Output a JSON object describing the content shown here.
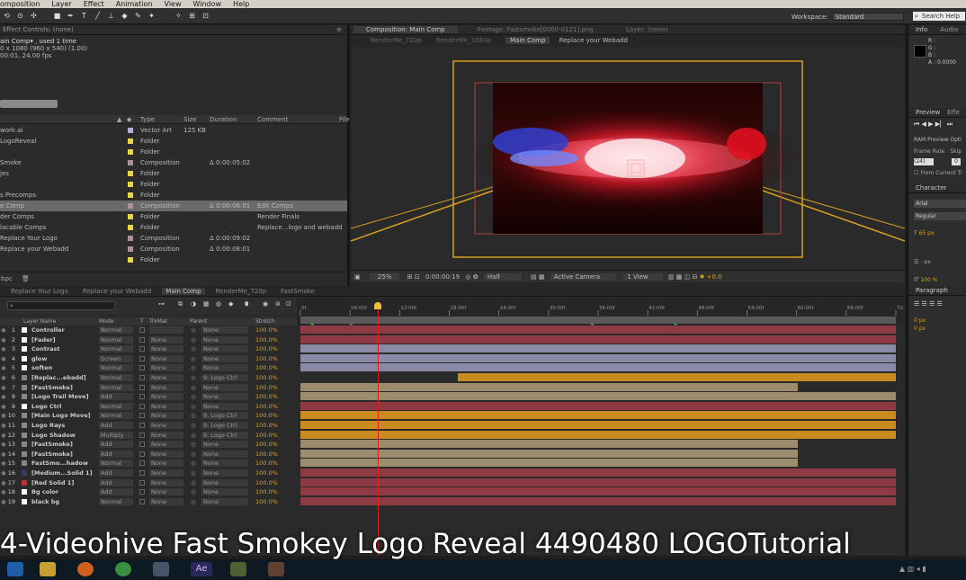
{
  "menu": [
    "omposition",
    "Layer",
    "Effect",
    "Animation",
    "View",
    "Window",
    "Help"
  ],
  "workspace": {
    "label": "Workspace:",
    "value": "Standard"
  },
  "search_label": "Search Help",
  "effect_controls": {
    "header": "Effect Controls: (none)",
    "comp_name": "ain Comp▾ , used 1 time",
    "size": "0 x 1080 (960 x 540) (1.00)",
    "duration": "00:01, 24.00 fps"
  },
  "project": {
    "headers": {
      "type": "Type",
      "size": "Size",
      "duration": "Duration",
      "comment": "Comment",
      "file": "File"
    },
    "rows": [
      {
        "name": "work.ai",
        "color": "#b0b0d8",
        "type": "Vector Art",
        "size": "125 KB",
        "duration": "",
        "comment": ""
      },
      {
        "name": "LogoReveal",
        "color": "#e8d840",
        "type": "Folder",
        "size": "",
        "duration": "",
        "comment": ""
      },
      {
        "name": "",
        "color": "#e8d840",
        "type": "Folder",
        "size": "",
        "duration": "",
        "comment": ""
      },
      {
        "name": "Smoke",
        "color": "#b09090",
        "type": "Composition",
        "size": "",
        "duration": "Δ 0:00:05:02",
        "comment": ""
      },
      {
        "name": "jes",
        "color": "#e8d840",
        "type": "Folder",
        "size": "",
        "duration": "",
        "comment": ""
      },
      {
        "name": "",
        "color": "#e8d840",
        "type": "Folder",
        "size": "",
        "duration": "",
        "comment": ""
      },
      {
        "name": "s Precomps",
        "color": "#e8d840",
        "type": "Folder",
        "size": "",
        "duration": "",
        "comment": ""
      },
      {
        "name": "e Comp",
        "color": "#b09090",
        "type": "Composition",
        "size": "",
        "duration": "Δ 0:00:06:01",
        "comment": "Edit Comps",
        "sel": true
      },
      {
        "name": "der Comps",
        "color": "#e8d840",
        "type": "Folder",
        "size": "",
        "duration": "",
        "comment": "Render Finals"
      },
      {
        "name": "lacable Comps",
        "color": "#e8d840",
        "type": "Folder",
        "size": "",
        "duration": "",
        "comment": "Replace...logo and webadd"
      },
      {
        "name": "Replace Your Logo",
        "color": "#b09090",
        "type": "Composition",
        "size": "",
        "duration": "Δ 0:00:09:02",
        "comment": ""
      },
      {
        "name": "Replace your Webadd",
        "color": "#b09090",
        "type": "Composition",
        "size": "",
        "duration": "Δ 0:00:08:01",
        "comment": ""
      },
      {
        "name": "",
        "color": "#e8d840",
        "type": "Folder",
        "size": "",
        "duration": "",
        "comment": ""
      }
    ],
    "bpc": "bpc"
  },
  "comp_viewer": {
    "header": "Composition: Main Comp",
    "footage_tab": "Footage: Fastsmoke[0000-0121].png",
    "layer_tab": "Layer: (none)",
    "subtabs": [
      "RenderMe_720p",
      "RenderMe_1080p",
      "Main Comp",
      "Replace your Webadd"
    ],
    "zoom": "25%",
    "timecode": "0:00:00:19",
    "resolution": "Half",
    "camera": "Active Camera",
    "views": "1 View",
    "exposure": "+0.0"
  },
  "right_panel": {
    "info_tab": "Info",
    "audio_tab": "Audio",
    "rgb": [
      "R :",
      "G :",
      "B :",
      "A : 0.0000"
    ],
    "preview_tab": "Preview",
    "effects_tab": "Effe",
    "ram_preview": "RAM Preview Opti",
    "frame_rate": "Frame Rate",
    "skip": "Skip",
    "fps": "(24)",
    "from_current": "From Current Ti",
    "character_tab": "Character",
    "font": "Arial",
    "style": "Regular",
    "size": "65 px",
    "px_label": "- px",
    "scale": "100 %",
    "paragraph_tab": "Paragraph",
    "indent": "0 px"
  },
  "timeline": {
    "tabs": [
      "Replace Your Logo",
      "Replace your Webadd",
      "Main Comp",
      "RenderMe_720p",
      "FastSmoke"
    ],
    "active_tab": 2,
    "headers": {
      "layer": "Layer Name",
      "mode": "Mode",
      "t": "T",
      "trkmat": "TrkMat",
      "parent": "Parent",
      "stretch": "Stretch"
    },
    "ruler": [
      "0f",
      "06:00f",
      "12:00f",
      "18:00f",
      "24:00f",
      "30:00f",
      "36:00f",
      "42:00f",
      "48:00f",
      "54:00f",
      "60:00f",
      "66:00f",
      "72:00f"
    ],
    "layers": [
      {
        "n": "1",
        "name": "Controller",
        "mode": "Normal",
        "trk": "",
        "parent": "None",
        "stretch": "100.0%",
        "swatch": "#ffffff",
        "bar": "#8e3a44",
        "start": 0,
        "end": 1.0
      },
      {
        "n": "2",
        "name": "[Fader]",
        "mode": "Normal",
        "trk": "None",
        "parent": "None",
        "stretch": "100.0%",
        "swatch": "#ffffff",
        "bar": "#8e3a44",
        "start": 0,
        "end": 1.0
      },
      {
        "n": "3",
        "name": "Contrast",
        "mode": "Normal",
        "trk": "None",
        "parent": "None",
        "stretch": "100.0%",
        "swatch": "#ffffff",
        "bar": "#8a8aa8",
        "start": 0,
        "end": 1.0
      },
      {
        "n": "4",
        "name": "glow",
        "mode": "Screen",
        "trk": "None",
        "parent": "None",
        "stretch": "100.0%",
        "swatch": "#ffffff",
        "bar": "#8a8aa8",
        "start": 0,
        "end": 1.0
      },
      {
        "n": "5",
        "name": "soften",
        "mode": "Normal",
        "trk": "None",
        "parent": "None",
        "stretch": "100.0%",
        "swatch": "#ffffff",
        "bar": "#8a8aa8",
        "start": 0,
        "end": 1.0
      },
      {
        "n": "6",
        "name": "[Replac...ebadd]",
        "mode": "Normal",
        "trk": "None",
        "parent": "9. Logo Ctrl",
        "stretch": "100.0%",
        "swatch": "#888888",
        "bar": "#c98a20",
        "start": 0.265,
        "end": 1.0
      },
      {
        "n": "7",
        "name": "[FastSmoke]",
        "mode": "Normal",
        "trk": "None",
        "parent": "None",
        "stretch": "100.0%",
        "swatch": "#888888",
        "bar": "#9b8c6e",
        "start": 0,
        "end": 0.835
      },
      {
        "n": "8",
        "name": "[Logo Trail Move]",
        "mode": "Add",
        "trk": "None",
        "parent": "None",
        "stretch": "100.0%",
        "swatch": "#888888",
        "bar": "#9b8c6e",
        "start": 0,
        "end": 1.0
      },
      {
        "n": "9",
        "name": "Logo Ctrl",
        "mode": "Normal",
        "trk": "None",
        "parent": "None",
        "stretch": "100.0%",
        "swatch": "#ffffff",
        "bar": "#8e3a44",
        "start": 0,
        "end": 1.0
      },
      {
        "n": "10",
        "name": "[Main Logo Move]",
        "mode": "Normal",
        "trk": "None",
        "parent": "9. Logo Ctrl",
        "stretch": "100.0%",
        "swatch": "#888888",
        "bar": "#c98a20",
        "start": 0,
        "end": 1.0
      },
      {
        "n": "11",
        "name": "Logo Rays",
        "mode": "Add",
        "trk": "None",
        "parent": "9. Logo Ctrl",
        "stretch": "100.0%",
        "swatch": "#888888",
        "bar": "#c98a20",
        "start": 0,
        "end": 1.0
      },
      {
        "n": "12",
        "name": "Logo Shadow",
        "mode": "Multiply",
        "trk": "None",
        "parent": "9. Logo Ctrl",
        "stretch": "100.0%",
        "swatch": "#888888",
        "bar": "#c98a20",
        "start": 0,
        "end": 1.0
      },
      {
        "n": "13",
        "name": "[FastSmoke]",
        "mode": "Add",
        "trk": "None",
        "parent": "None",
        "stretch": "100.0%",
        "swatch": "#888888",
        "bar": "#9b8c6e",
        "start": 0,
        "end": 0.835
      },
      {
        "n": "14",
        "name": "[FastSmoke]",
        "mode": "Add",
        "trk": "None",
        "parent": "None",
        "stretch": "100.0%",
        "swatch": "#888888",
        "bar": "#9b8c6e",
        "start": 0,
        "end": 0.835
      },
      {
        "n": "15",
        "name": "FastSmo...hadow",
        "mode": "Normal",
        "trk": "None",
        "parent": "None",
        "stretch": "100.0%",
        "swatch": "#888888",
        "bar": "#9b8c6e",
        "start": 0,
        "end": 0.835
      },
      {
        "n": "16",
        "name": "[Medium...Solid 1]",
        "mode": "Add",
        "trk": "None",
        "parent": "None",
        "stretch": "100.0%",
        "swatch": "#3a3a6a",
        "bar": "#8e3a44",
        "start": 0,
        "end": 1.0
      },
      {
        "n": "17",
        "name": "[Red Solid 1]",
        "mode": "Add",
        "trk": "None",
        "parent": "None",
        "stretch": "100.0%",
        "swatch": "#c03030",
        "bar": "#8e3a44",
        "start": 0,
        "end": 1.0
      },
      {
        "n": "18",
        "name": "Bg color",
        "mode": "Add",
        "trk": "None",
        "parent": "None",
        "stretch": "100.0%",
        "swatch": "#ffffff",
        "bar": "#8e3a44",
        "start": 0,
        "end": 1.0
      },
      {
        "n": "19",
        "name": "black bg",
        "mode": "Normal",
        "trk": "None",
        "parent": "None",
        "stretch": "100.0%",
        "swatch": "#ffffff",
        "bar": "#8e3a44",
        "start": 0,
        "end": 1.0
      }
    ],
    "playhead_fraction": 0.13
  },
  "subtitle": "4-Videohive Fast Smokey Logo Reveal 4490480 LOGOTutorial",
  "taskbar_icons": [
    "ie-icon",
    "folder-icon",
    "media-icon",
    "chrome-icon",
    "app-icon",
    "after-effects-icon",
    "app2-icon",
    "app3-icon"
  ],
  "taskbar_ae": "Ae"
}
